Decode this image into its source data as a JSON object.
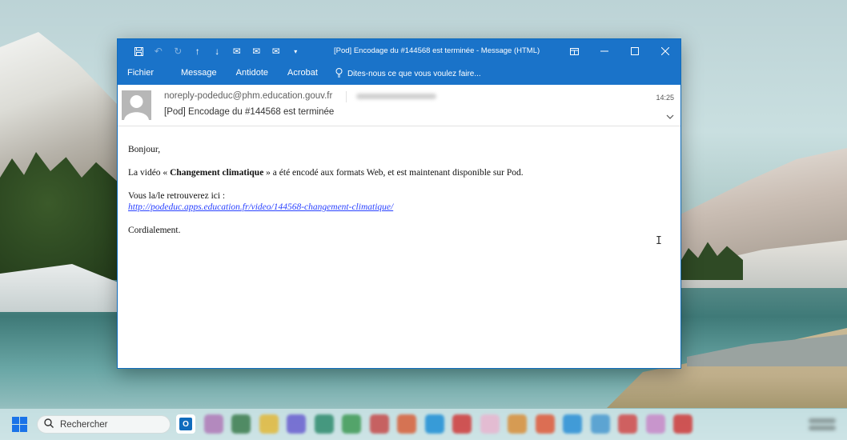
{
  "window": {
    "title": "[Pod] Encodage du #144568 est terminée - Message (HTML)",
    "ribbon_tabs": [
      "Fichier",
      "Message",
      "Antidote",
      "Acrobat"
    ],
    "tell_me": "Dites-nous ce que vous voulez faire..."
  },
  "email": {
    "sender": "noreply-podeduc@phm.education.gouv.fr",
    "time": "14:25",
    "subject": "[Pod] Encodage du #144568 est terminée",
    "greeting": "Bonjour,",
    "line1_before": "La vidéo « ",
    "video_title": "Changement climatique",
    "line1_after": " » a été encodé aux formats Web, et est maintenant disponible sur Pod.",
    "find_text": "Vous la/le retrouverez ici :",
    "link": "http://podeduc.apps.education.fr/video/144568-changement-climatique/",
    "closing": "Cordialement."
  },
  "taskbar": {
    "search_placeholder": "Rechercher",
    "outlook_letter": "O",
    "colors": {
      "accent": "#1a73c9",
      "link": "#2a42ff"
    },
    "icon_colors": [
      "#b07ab8",
      "#3c7d4e",
      "#e2b93b",
      "#6a5fd0",
      "#2f8c6e",
      "#3f9a55",
      "#c64b4b",
      "#d8603a",
      "#1e8fd6",
      "#d03b3b",
      "#e8b6d0",
      "#d98f3a",
      "#e05a3a",
      "#2a8fd6",
      "#4a9ad0",
      "#d14a4a",
      "#c888c8",
      "#cf3b3b"
    ]
  }
}
